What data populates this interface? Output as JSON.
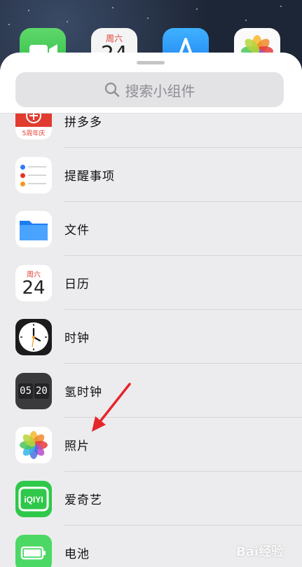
{
  "home_screen": {
    "calendar_weekday": "周六",
    "calendar_day": "24"
  },
  "search": {
    "placeholder": "搜索小组件"
  },
  "widgets": [
    {
      "label": "拼多多",
      "icon": "pinduoduo-icon",
      "icon_caption": "5周年庆"
    },
    {
      "label": "提醒事项",
      "icon": "reminders-icon"
    },
    {
      "label": "文件",
      "icon": "files-icon"
    },
    {
      "label": "日历",
      "icon": "calendar-icon",
      "weekday": "周六",
      "day": "24"
    },
    {
      "label": "时钟",
      "icon": "clock-icon"
    },
    {
      "label": "氢时钟",
      "icon": "flip-clock-icon",
      "hour": "05",
      "minute": "20"
    },
    {
      "label": "照片",
      "icon": "photos-icon"
    },
    {
      "label": "爱奇艺",
      "icon": "iqiyi-icon",
      "logo_text": "iQIYI"
    },
    {
      "label": "电池",
      "icon": "battery-icon"
    }
  ],
  "annotation": {
    "arrow_color": "#e5262b",
    "target": "照片"
  },
  "watermark": {
    "text": "Bai经验"
  },
  "colors": {
    "sheet_bg": "#ececee",
    "accent_red": "#e23b2f"
  }
}
